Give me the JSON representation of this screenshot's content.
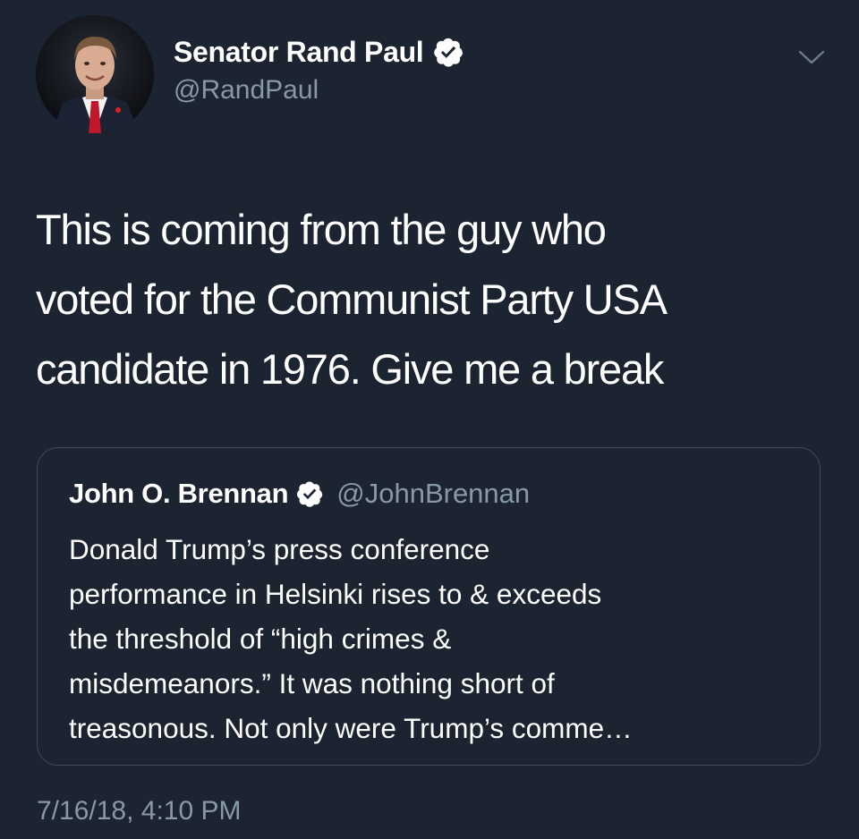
{
  "author": {
    "name": "Senator Rand Paul",
    "handle": "@RandPaul",
    "verified": true,
    "avatar_icon": "profile-photo"
  },
  "tweet": {
    "text_lines": [
      "This is coming from the guy who",
      "voted for the Communist Party USA",
      "candidate in 1976. Give me a break"
    ],
    "timestamp": "7/16/18, 4:10 PM"
  },
  "quoted_tweet": {
    "name": "John O. Brennan",
    "handle": "@JohnBrennan",
    "verified": true,
    "text_lines": [
      "Donald Trump’s press conference",
      "performance in Helsinki rises to & exceeds",
      "the threshold of “high crimes &",
      "misdemeanors.” It was nothing short of",
      "treasonous. Not only were Trump’s comme…"
    ]
  },
  "icons": {
    "verified": "verified-badge-icon",
    "menu": "chevron-down-icon"
  },
  "colors": {
    "background": "#1b2430",
    "primary_text": "#ffffff",
    "secondary_text": "#8899a6",
    "card_border": "#3d4a57"
  }
}
